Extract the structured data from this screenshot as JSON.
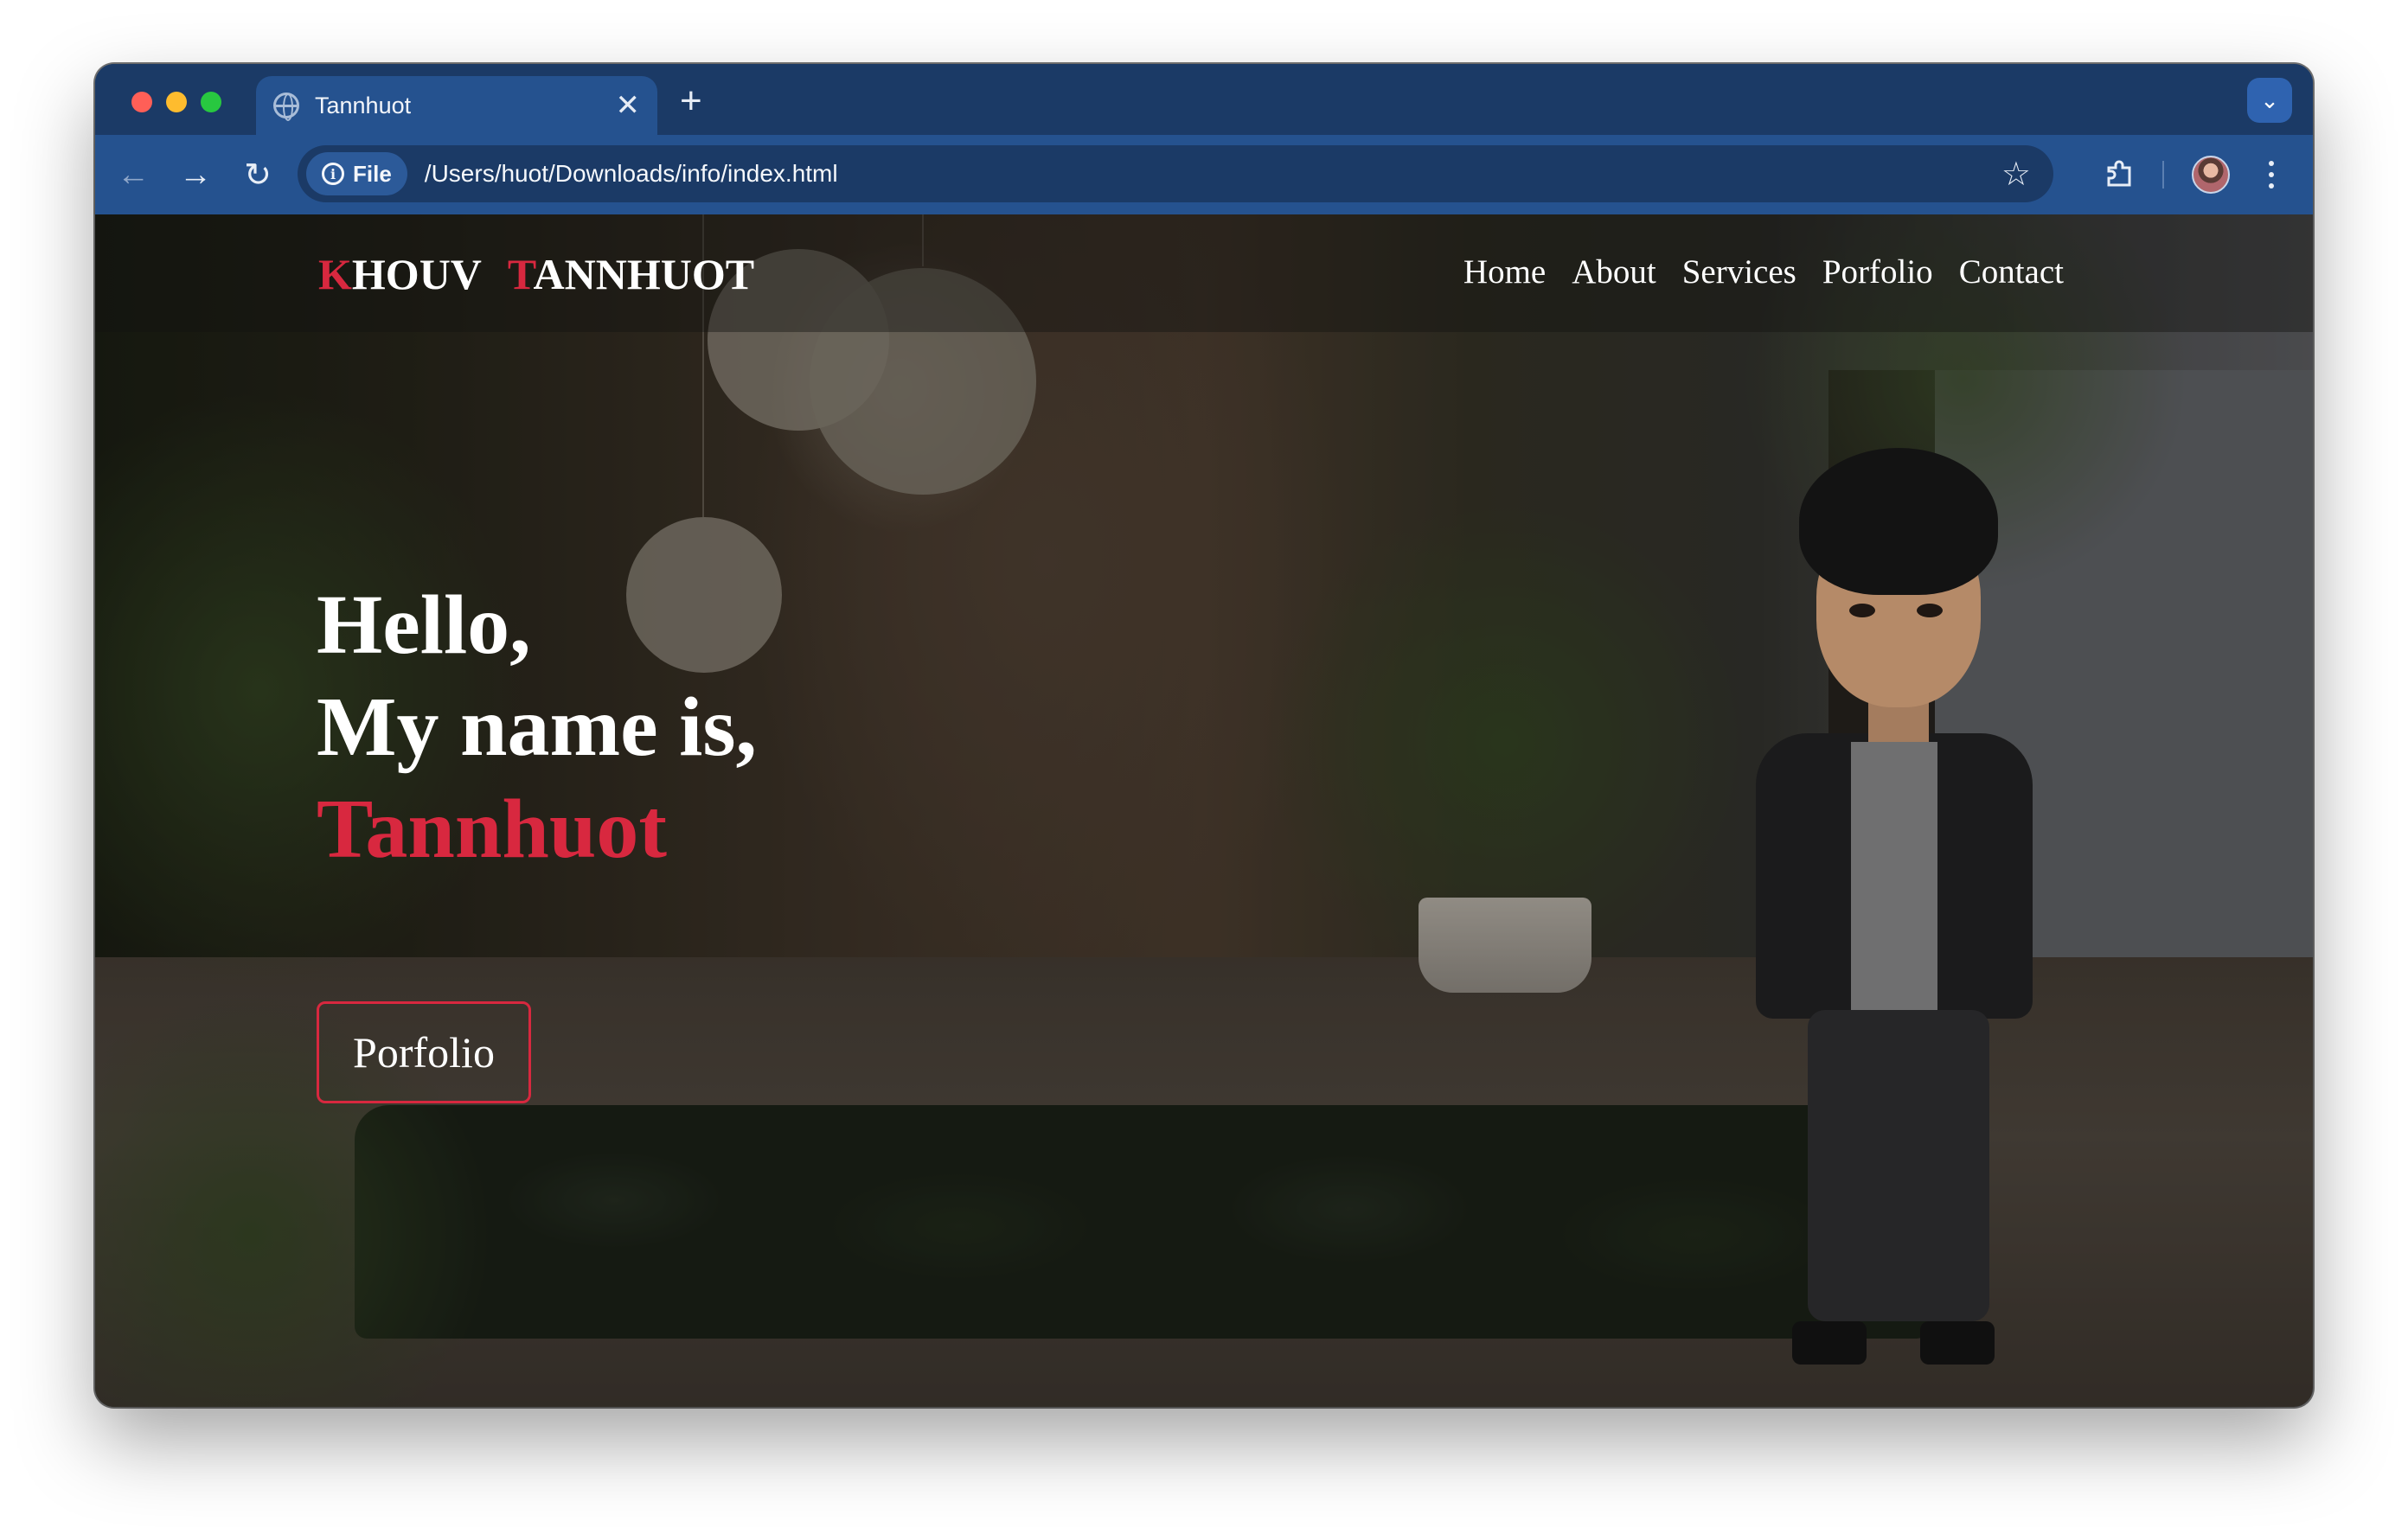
{
  "browser": {
    "tab_title": "Tannhuot",
    "tab_close_glyph": "✕",
    "new_tab_glyph": "+",
    "tab_menu_glyph": "⌄",
    "back_glyph": "←",
    "forward_glyph": "→",
    "reload_glyph": "↻",
    "file_chip_label": "File",
    "info_glyph": "i",
    "url": "/Users/huot/Downloads/info/index.html",
    "star_glyph": "☆",
    "icons": [
      "globe-icon",
      "close-icon",
      "plus-icon",
      "chevron-down-icon",
      "back-arrow-icon",
      "forward-arrow-icon",
      "reload-icon",
      "info-icon",
      "star-icon",
      "puzzle-icon",
      "profile-avatar",
      "kebab-menu-icon"
    ]
  },
  "site": {
    "logo": {
      "first_initial": "K",
      "first_rest": "HOUV",
      "last_initial": "T",
      "last_rest": "ANNHUOT"
    },
    "nav": [
      {
        "label": "Home"
      },
      {
        "label": "About"
      },
      {
        "label": "Services"
      },
      {
        "label": "Porfolio"
      },
      {
        "label": "Contact"
      }
    ],
    "hero": {
      "line1": "Hello,",
      "line2": "My name is,",
      "name": "Tannhuot",
      "button_label": "Porfolio"
    }
  },
  "colors": {
    "accent": "#d8283f",
    "tabstrip": "#1b3a66",
    "toolbar": "#25528f",
    "text": "#ffffff"
  }
}
